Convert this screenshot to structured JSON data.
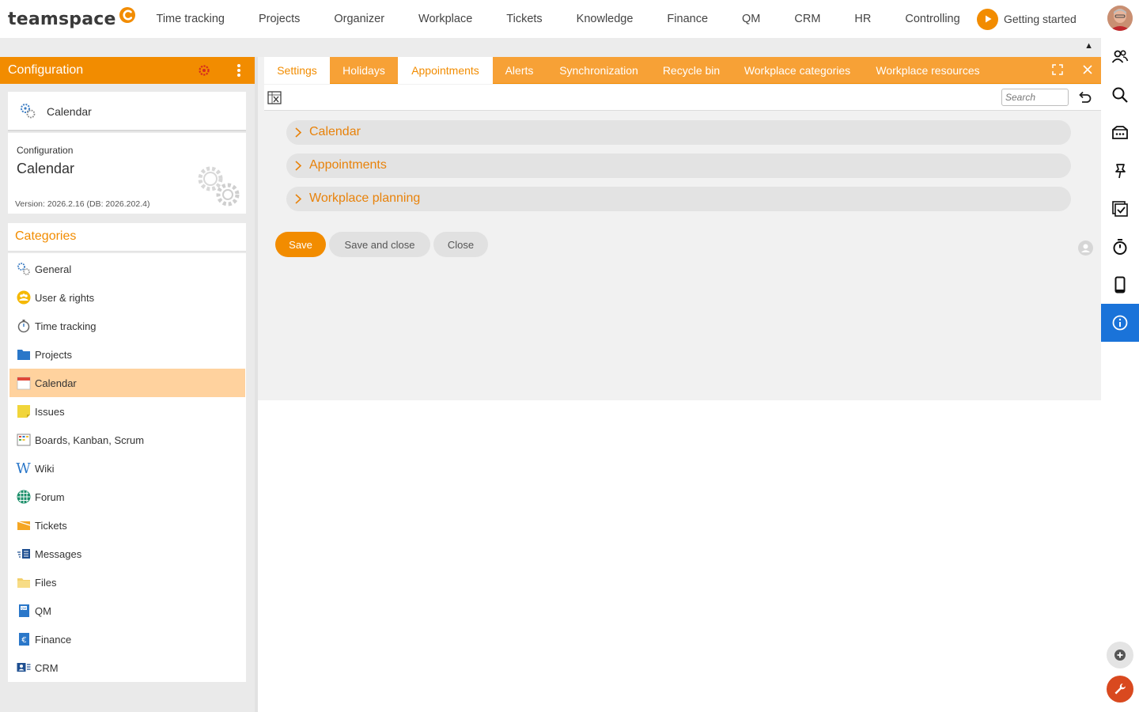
{
  "app": {
    "logo_text": "teamspace",
    "nav": [
      "Time tracking",
      "Projects",
      "Organizer",
      "Workplace",
      "Tickets",
      "Knowledge",
      "Finance",
      "QM",
      "CRM",
      "HR",
      "Controlling"
    ],
    "getting_started": "Getting started"
  },
  "left_panel": {
    "title": "Configuration",
    "selected_item": "Calendar",
    "info_small": "Configuration",
    "info_big": "Calendar",
    "version": "Version: 2026.2.16 (DB: 2026.202.4)",
    "categories_title": "Categories",
    "categories": [
      {
        "label": "General",
        "icon": "gears-icon"
      },
      {
        "label": "User & rights",
        "icon": "users-icon"
      },
      {
        "label": "Time tracking",
        "icon": "stopwatch-icon"
      },
      {
        "label": "Projects",
        "icon": "folder-icon"
      },
      {
        "label": "Calendar",
        "icon": "calendar-icon",
        "active": true
      },
      {
        "label": "Issues",
        "icon": "sticky-note-icon"
      },
      {
        "label": "Boards, Kanban, Scrum",
        "icon": "board-icon"
      },
      {
        "label": "Wiki",
        "icon": "wiki-icon"
      },
      {
        "label": "Forum",
        "icon": "forum-icon"
      },
      {
        "label": "Tickets",
        "icon": "ticket-icon"
      },
      {
        "label": "Messages",
        "icon": "messages-icon"
      },
      {
        "label": "Files",
        "icon": "files-icon"
      },
      {
        "label": "QM",
        "icon": "qm-icon"
      },
      {
        "label": "Finance",
        "icon": "finance-icon"
      },
      {
        "label": "CRM",
        "icon": "crm-icon"
      }
    ]
  },
  "tabs": [
    "Settings",
    "Holidays",
    "Appointments",
    "Alerts",
    "Synchronization",
    "Recycle bin",
    "Workplace categories",
    "Workplace resources"
  ],
  "active_tab": "Appointments",
  "toolbar": {
    "search_placeholder": "Search"
  },
  "sections": [
    "Calendar",
    "Appointments",
    "Workplace planning"
  ],
  "buttons": {
    "save": "Save",
    "save_close": "Save and close",
    "close": "Close"
  },
  "colors": {
    "accent": "#f28c00",
    "tab_bar": "#f7a136",
    "active_category": "#ffd29e",
    "info_active": "#1a73d9"
  }
}
